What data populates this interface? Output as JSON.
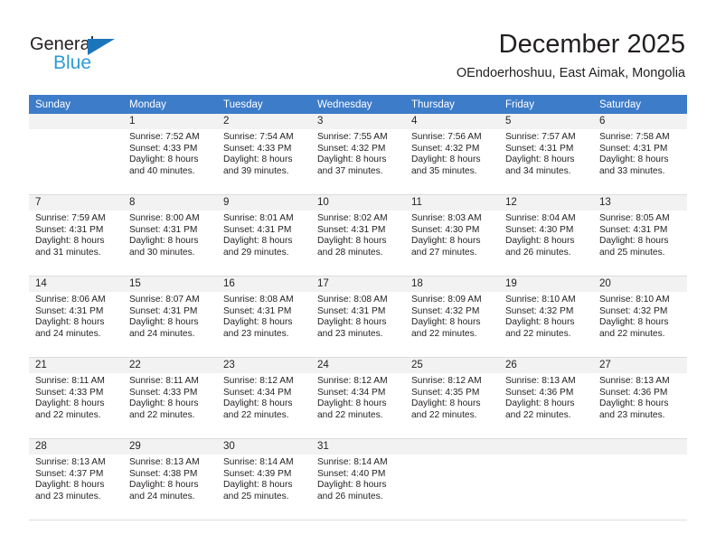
{
  "brand": {
    "name_part1": "General",
    "name_part2": "Blue",
    "triangle_icon": "blue-triangle-icon",
    "accent_color": "#1b75bb",
    "secondary_color": "#2e9bd6"
  },
  "header": {
    "title": "December 2025",
    "subtitle": "OEndoerhoshuu, East Aimak, Mongolia"
  },
  "calendar": {
    "header_color": "#3d7cc9",
    "weekday_headers": [
      "Sunday",
      "Monday",
      "Tuesday",
      "Wednesday",
      "Thursday",
      "Friday",
      "Saturday"
    ],
    "weeks": [
      [
        {
          "day": "",
          "sunrise": "",
          "sunset": "",
          "daylight_line1": "",
          "daylight_line2": "",
          "empty": true
        },
        {
          "day": "1",
          "sunrise": "Sunrise: 7:52 AM",
          "sunset": "Sunset: 4:33 PM",
          "daylight_line1": "Daylight: 8 hours",
          "daylight_line2": "and 40 minutes.",
          "empty": false
        },
        {
          "day": "2",
          "sunrise": "Sunrise: 7:54 AM",
          "sunset": "Sunset: 4:33 PM",
          "daylight_line1": "Daylight: 8 hours",
          "daylight_line2": "and 39 minutes.",
          "empty": false
        },
        {
          "day": "3",
          "sunrise": "Sunrise: 7:55 AM",
          "sunset": "Sunset: 4:32 PM",
          "daylight_line1": "Daylight: 8 hours",
          "daylight_line2": "and 37 minutes.",
          "empty": false
        },
        {
          "day": "4",
          "sunrise": "Sunrise: 7:56 AM",
          "sunset": "Sunset: 4:32 PM",
          "daylight_line1": "Daylight: 8 hours",
          "daylight_line2": "and 35 minutes.",
          "empty": false
        },
        {
          "day": "5",
          "sunrise": "Sunrise: 7:57 AM",
          "sunset": "Sunset: 4:31 PM",
          "daylight_line1": "Daylight: 8 hours",
          "daylight_line2": "and 34 minutes.",
          "empty": false
        },
        {
          "day": "6",
          "sunrise": "Sunrise: 7:58 AM",
          "sunset": "Sunset: 4:31 PM",
          "daylight_line1": "Daylight: 8 hours",
          "daylight_line2": "and 33 minutes.",
          "empty": false
        }
      ],
      [
        {
          "day": "7",
          "sunrise": "Sunrise: 7:59 AM",
          "sunset": "Sunset: 4:31 PM",
          "daylight_line1": "Daylight: 8 hours",
          "daylight_line2": "and 31 minutes.",
          "empty": false
        },
        {
          "day": "8",
          "sunrise": "Sunrise: 8:00 AM",
          "sunset": "Sunset: 4:31 PM",
          "daylight_line1": "Daylight: 8 hours",
          "daylight_line2": "and 30 minutes.",
          "empty": false
        },
        {
          "day": "9",
          "sunrise": "Sunrise: 8:01 AM",
          "sunset": "Sunset: 4:31 PM",
          "daylight_line1": "Daylight: 8 hours",
          "daylight_line2": "and 29 minutes.",
          "empty": false
        },
        {
          "day": "10",
          "sunrise": "Sunrise: 8:02 AM",
          "sunset": "Sunset: 4:31 PM",
          "daylight_line1": "Daylight: 8 hours",
          "daylight_line2": "and 28 minutes.",
          "empty": false
        },
        {
          "day": "11",
          "sunrise": "Sunrise: 8:03 AM",
          "sunset": "Sunset: 4:30 PM",
          "daylight_line1": "Daylight: 8 hours",
          "daylight_line2": "and 27 minutes.",
          "empty": false
        },
        {
          "day": "12",
          "sunrise": "Sunrise: 8:04 AM",
          "sunset": "Sunset: 4:30 PM",
          "daylight_line1": "Daylight: 8 hours",
          "daylight_line2": "and 26 minutes.",
          "empty": false
        },
        {
          "day": "13",
          "sunrise": "Sunrise: 8:05 AM",
          "sunset": "Sunset: 4:31 PM",
          "daylight_line1": "Daylight: 8 hours",
          "daylight_line2": "and 25 minutes.",
          "empty": false
        }
      ],
      [
        {
          "day": "14",
          "sunrise": "Sunrise: 8:06 AM",
          "sunset": "Sunset: 4:31 PM",
          "daylight_line1": "Daylight: 8 hours",
          "daylight_line2": "and 24 minutes.",
          "empty": false
        },
        {
          "day": "15",
          "sunrise": "Sunrise: 8:07 AM",
          "sunset": "Sunset: 4:31 PM",
          "daylight_line1": "Daylight: 8 hours",
          "daylight_line2": "and 24 minutes.",
          "empty": false
        },
        {
          "day": "16",
          "sunrise": "Sunrise: 8:08 AM",
          "sunset": "Sunset: 4:31 PM",
          "daylight_line1": "Daylight: 8 hours",
          "daylight_line2": "and 23 minutes.",
          "empty": false
        },
        {
          "day": "17",
          "sunrise": "Sunrise: 8:08 AM",
          "sunset": "Sunset: 4:31 PM",
          "daylight_line1": "Daylight: 8 hours",
          "daylight_line2": "and 23 minutes.",
          "empty": false
        },
        {
          "day": "18",
          "sunrise": "Sunrise: 8:09 AM",
          "sunset": "Sunset: 4:32 PM",
          "daylight_line1": "Daylight: 8 hours",
          "daylight_line2": "and 22 minutes.",
          "empty": false
        },
        {
          "day": "19",
          "sunrise": "Sunrise: 8:10 AM",
          "sunset": "Sunset: 4:32 PM",
          "daylight_line1": "Daylight: 8 hours",
          "daylight_line2": "and 22 minutes.",
          "empty": false
        },
        {
          "day": "20",
          "sunrise": "Sunrise: 8:10 AM",
          "sunset": "Sunset: 4:32 PM",
          "daylight_line1": "Daylight: 8 hours",
          "daylight_line2": "and 22 minutes.",
          "empty": false
        }
      ],
      [
        {
          "day": "21",
          "sunrise": "Sunrise: 8:11 AM",
          "sunset": "Sunset: 4:33 PM",
          "daylight_line1": "Daylight: 8 hours",
          "daylight_line2": "and 22 minutes.",
          "empty": false
        },
        {
          "day": "22",
          "sunrise": "Sunrise: 8:11 AM",
          "sunset": "Sunset: 4:33 PM",
          "daylight_line1": "Daylight: 8 hours",
          "daylight_line2": "and 22 minutes.",
          "empty": false
        },
        {
          "day": "23",
          "sunrise": "Sunrise: 8:12 AM",
          "sunset": "Sunset: 4:34 PM",
          "daylight_line1": "Daylight: 8 hours",
          "daylight_line2": "and 22 minutes.",
          "empty": false
        },
        {
          "day": "24",
          "sunrise": "Sunrise: 8:12 AM",
          "sunset": "Sunset: 4:34 PM",
          "daylight_line1": "Daylight: 8 hours",
          "daylight_line2": "and 22 minutes.",
          "empty": false
        },
        {
          "day": "25",
          "sunrise": "Sunrise: 8:12 AM",
          "sunset": "Sunset: 4:35 PM",
          "daylight_line1": "Daylight: 8 hours",
          "daylight_line2": "and 22 minutes.",
          "empty": false
        },
        {
          "day": "26",
          "sunrise": "Sunrise: 8:13 AM",
          "sunset": "Sunset: 4:36 PM",
          "daylight_line1": "Daylight: 8 hours",
          "daylight_line2": "and 22 minutes.",
          "empty": false
        },
        {
          "day": "27",
          "sunrise": "Sunrise: 8:13 AM",
          "sunset": "Sunset: 4:36 PM",
          "daylight_line1": "Daylight: 8 hours",
          "daylight_line2": "and 23 minutes.",
          "empty": false
        }
      ],
      [
        {
          "day": "28",
          "sunrise": "Sunrise: 8:13 AM",
          "sunset": "Sunset: 4:37 PM",
          "daylight_line1": "Daylight: 8 hours",
          "daylight_line2": "and 23 minutes.",
          "empty": false
        },
        {
          "day": "29",
          "sunrise": "Sunrise: 8:13 AM",
          "sunset": "Sunset: 4:38 PM",
          "daylight_line1": "Daylight: 8 hours",
          "daylight_line2": "and 24 minutes.",
          "empty": false
        },
        {
          "day": "30",
          "sunrise": "Sunrise: 8:14 AM",
          "sunset": "Sunset: 4:39 PM",
          "daylight_line1": "Daylight: 8 hours",
          "daylight_line2": "and 25 minutes.",
          "empty": false
        },
        {
          "day": "31",
          "sunrise": "Sunrise: 8:14 AM",
          "sunset": "Sunset: 4:40 PM",
          "daylight_line1": "Daylight: 8 hours",
          "daylight_line2": "and 26 minutes.",
          "empty": false
        },
        {
          "day": "",
          "sunrise": "",
          "sunset": "",
          "daylight_line1": "",
          "daylight_line2": "",
          "empty": true
        },
        {
          "day": "",
          "sunrise": "",
          "sunset": "",
          "daylight_line1": "",
          "daylight_line2": "",
          "empty": true
        },
        {
          "day": "",
          "sunrise": "",
          "sunset": "",
          "daylight_line1": "",
          "daylight_line2": "",
          "empty": true
        }
      ]
    ]
  }
}
